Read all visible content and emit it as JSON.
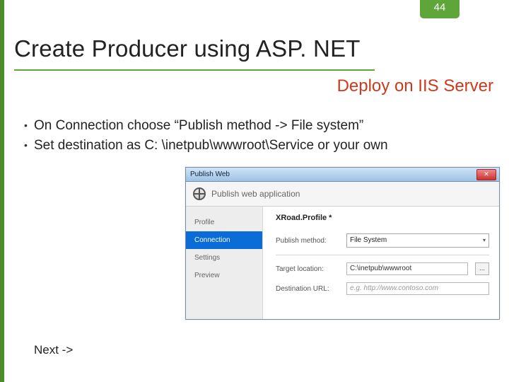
{
  "page_number": "44",
  "title": "Create Producer using ASP. NET",
  "subtitle": "Deploy on IIS Server",
  "bullets": [
    "On Connection choose “Publish method -> File system”",
    "Set destination as C: \\inetpub\\wwwroot\\Service or your own"
  ],
  "next_label": "Next ->",
  "dialog": {
    "window_title": "Publish Web",
    "close_glyph": "✕",
    "header_text": "Publish web application",
    "sidebar": {
      "items": [
        {
          "label": "Profile"
        },
        {
          "label": "Connection"
        },
        {
          "label": "Settings"
        },
        {
          "label": "Preview"
        }
      ]
    },
    "profile_name": "XRoad.Profile *",
    "fields": {
      "publish_method": {
        "label": "Publish method:",
        "value": "File System"
      },
      "target_location": {
        "label": "Target location:",
        "value": "C:\\inetpub\\wwwroot",
        "browse": "..."
      },
      "destination_url": {
        "label": "Destination URL:",
        "placeholder": "e.g. http://www.contoso.com"
      }
    }
  }
}
